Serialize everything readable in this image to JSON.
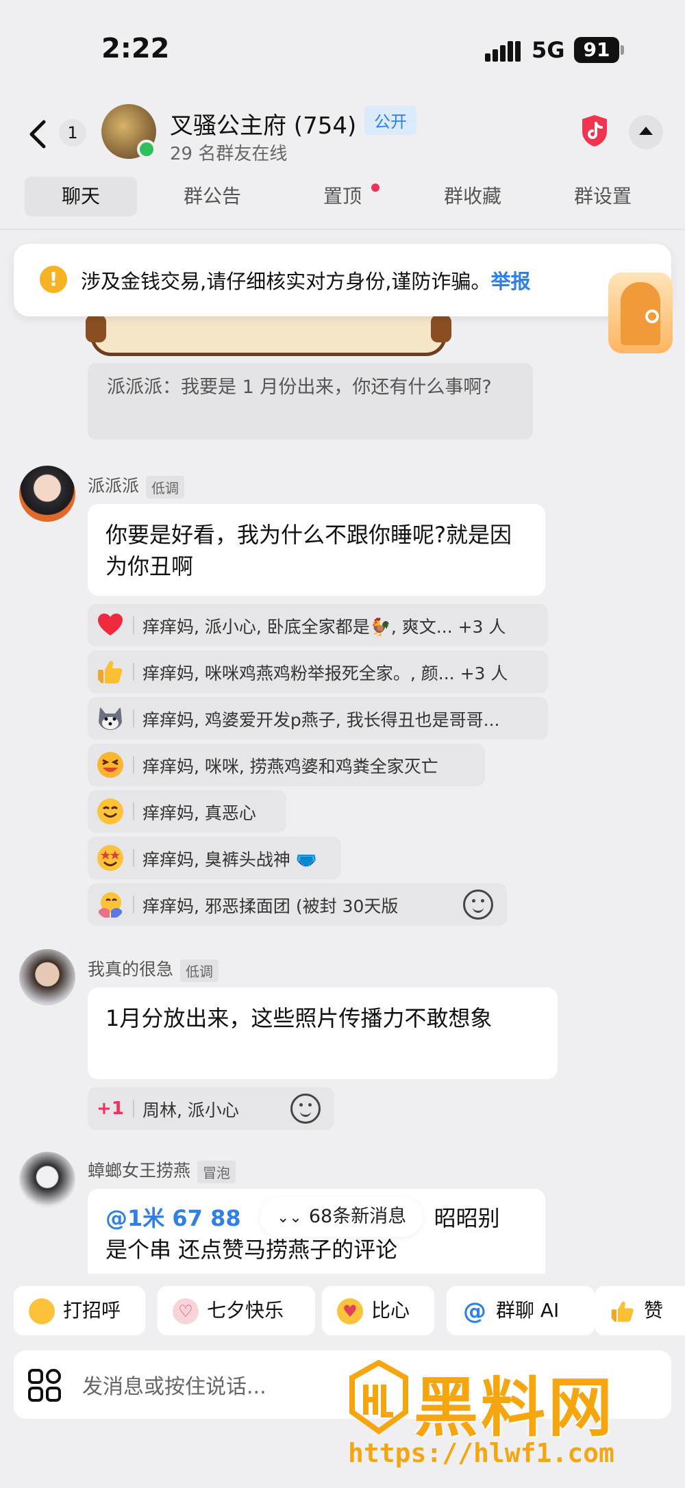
{
  "status_bar": {
    "time": "2:22",
    "network": "5G",
    "battery": "91"
  },
  "header": {
    "unread_count": "1",
    "group_name": "叉骚公主府 (754)",
    "visibility": "公开",
    "online_text": "29 名群友在线"
  },
  "tabs": [
    "聊天",
    "群公告",
    "置顶",
    "群收藏",
    "群设置"
  ],
  "warning": {
    "text": "涉及金钱交易,请仔细核实对方身份,谨防诈骗。",
    "link": "举报"
  },
  "quote": {
    "text": "派派派：我要是 1 月份出来，你还有什么事啊?"
  },
  "messages": [
    {
      "sender": "派派派",
      "tag": "低调",
      "text": "你要是好看，我为什么不跟你睡呢?就是因为你丑啊",
      "reactions": [
        {
          "icon": "heart",
          "text": "痒痒妈, 派小心, 卧底全家都是🐓, 爽文... +3 人"
        },
        {
          "icon": "thumbs-up",
          "text": "痒痒妈, 咪咪鸡燕鸡粉举报死全家。, 颜... +3 人"
        },
        {
          "icon": "husky",
          "text": "痒痒妈, 鸡婆爱开发p燕子, 我长得丑也是哥哥..."
        },
        {
          "icon": "laugh",
          "text": "痒痒妈, 咪咪, 捞燕鸡婆和鸡粪全家灭亡"
        },
        {
          "icon": "smile",
          "text": "痒痒妈, 真恶心"
        },
        {
          "icon": "star-eyes",
          "text": "痒痒妈, 臭裤头战神 🩲"
        },
        {
          "icon": "hug",
          "text": "痒痒妈, 邪恶揉面团 (被封 30天版"
        }
      ]
    },
    {
      "sender": "我真的很急",
      "tag": "低调",
      "text": "1月分放出来，这些照片传播力不敢想象",
      "reactions": [
        {
          "icon": "plus-one",
          "label": "+1",
          "text": "周林, 派小心"
        }
      ]
    },
    {
      "sender": "蟑螂女王捞燕",
      "tag": "冒泡",
      "mention": "@1米 67 88",
      "text_line1_tail": "、昭昭别",
      "text_line2": "是个串 还点赞马捞燕子的评论"
    }
  ],
  "new_messages": "68条新消息",
  "quick_actions": [
    "打招呼",
    "七夕快乐",
    "比心",
    "群聊 AI",
    "赞"
  ],
  "input": {
    "placeholder": "发消息或按住说话..."
  },
  "watermark": {
    "title": "黑料网",
    "url": "https://hlwf1.com"
  },
  "colors": {
    "link": "#2f7fe6",
    "warning": "#f5b324",
    "online": "#2ec05a",
    "watermark": "#f5a60f"
  }
}
